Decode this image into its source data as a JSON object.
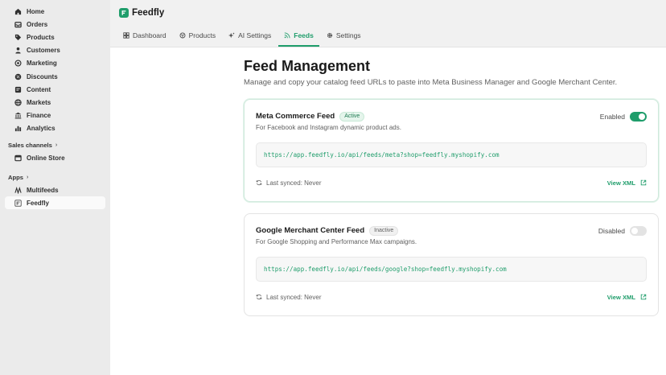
{
  "sidebar": {
    "items": [
      {
        "label": "Home",
        "icon": "home-icon"
      },
      {
        "label": "Orders",
        "icon": "inbox-icon"
      },
      {
        "label": "Products",
        "icon": "tag-icon"
      },
      {
        "label": "Customers",
        "icon": "person-icon"
      },
      {
        "label": "Marketing",
        "icon": "target-icon"
      },
      {
        "label": "Discounts",
        "icon": "discount-icon"
      },
      {
        "label": "Content",
        "icon": "content-icon"
      },
      {
        "label": "Markets",
        "icon": "globe-icon"
      },
      {
        "label": "Finance",
        "icon": "bank-icon"
      },
      {
        "label": "Analytics",
        "icon": "bar-chart-icon"
      }
    ],
    "sales_channels_label": "Sales channels",
    "online_store_label": "Online Store",
    "apps_label": "Apps",
    "multifeeds_label": "Multifeeds",
    "feedfly_label": "Feedfly"
  },
  "app": {
    "name": "Feedfly",
    "accent": "#1f9d6b"
  },
  "tabs": [
    {
      "label": "Dashboard",
      "icon": "dashboard-icon"
    },
    {
      "label": "Products",
      "icon": "product-icon"
    },
    {
      "label": "AI Settings",
      "icon": "sparkle-icon"
    },
    {
      "label": "Feeds",
      "icon": "rss-icon"
    },
    {
      "label": "Settings",
      "icon": "gear-icon"
    }
  ],
  "active_tab": "Feeds",
  "page": {
    "title": "Feed Management",
    "subtitle": "Manage and copy your catalog feed URLs to paste into Meta Business Manager and Google Merchant Center."
  },
  "feeds": [
    {
      "title": "Meta Commerce Feed",
      "badge": "Active",
      "toggle_label": "Enabled",
      "enabled": true,
      "description": "For Facebook and Instagram dynamic product ads.",
      "url": "https://app.feedfly.io/api/feeds/meta?shop=feedfly.myshopify.com",
      "sync": "Last synced: Never",
      "view_label": "View XML"
    },
    {
      "title": "Google Merchant Center Feed",
      "badge": "Inactive",
      "toggle_label": "Disabled",
      "enabled": false,
      "description": "For Google Shopping and Performance Max campaigns.",
      "url": "https://app.feedfly.io/api/feeds/google?shop=feedfly.myshopify.com",
      "sync": "Last synced: Never",
      "view_label": "View XML"
    }
  ]
}
